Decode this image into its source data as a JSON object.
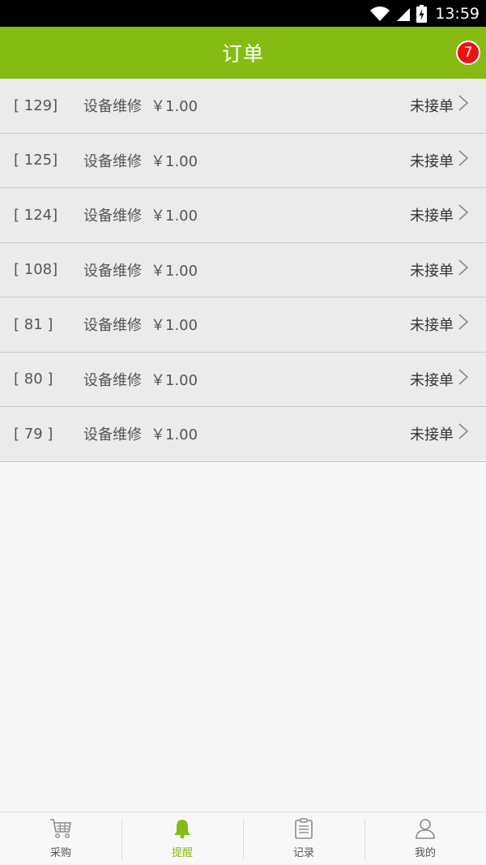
{
  "status_bar": {
    "time": "13:59",
    "icons": [
      "wifi-icon",
      "signal-icon",
      "battery-charging-icon"
    ]
  },
  "header": {
    "title": "订单",
    "badge_count": "7"
  },
  "orders": [
    {
      "id": "[ 129]",
      "name": "设备维修",
      "price": "￥1.00",
      "status": "未接单"
    },
    {
      "id": "[ 125]",
      "name": "设备维修",
      "price": "￥1.00",
      "status": "未接单"
    },
    {
      "id": "[ 124]",
      "name": "设备维修",
      "price": "￥1.00",
      "status": "未接单"
    },
    {
      "id": "[ 108]",
      "name": "设备维修",
      "price": "￥1.00",
      "status": "未接单"
    },
    {
      "id": "[ 81 ]",
      "name": "设备维修",
      "price": "￥1.00",
      "status": "未接单"
    },
    {
      "id": "[ 80 ]",
      "name": "设备维修",
      "price": "￥1.00",
      "status": "未接单"
    },
    {
      "id": "[ 79 ]",
      "name": "设备维修",
      "price": "￥1.00",
      "status": "未接单"
    }
  ],
  "bottom_nav": {
    "items": [
      {
        "label": "采购",
        "icon": "cart-icon",
        "active": false
      },
      {
        "label": "提醒",
        "icon": "bell-icon",
        "active": true
      },
      {
        "label": "记录",
        "icon": "clipboard-icon",
        "active": false
      },
      {
        "label": "我的",
        "icon": "user-icon",
        "active": false
      }
    ]
  },
  "colors": {
    "brand_green": "#86bb13",
    "badge_red": "#ee1111",
    "row_background": "#ebebeb"
  }
}
